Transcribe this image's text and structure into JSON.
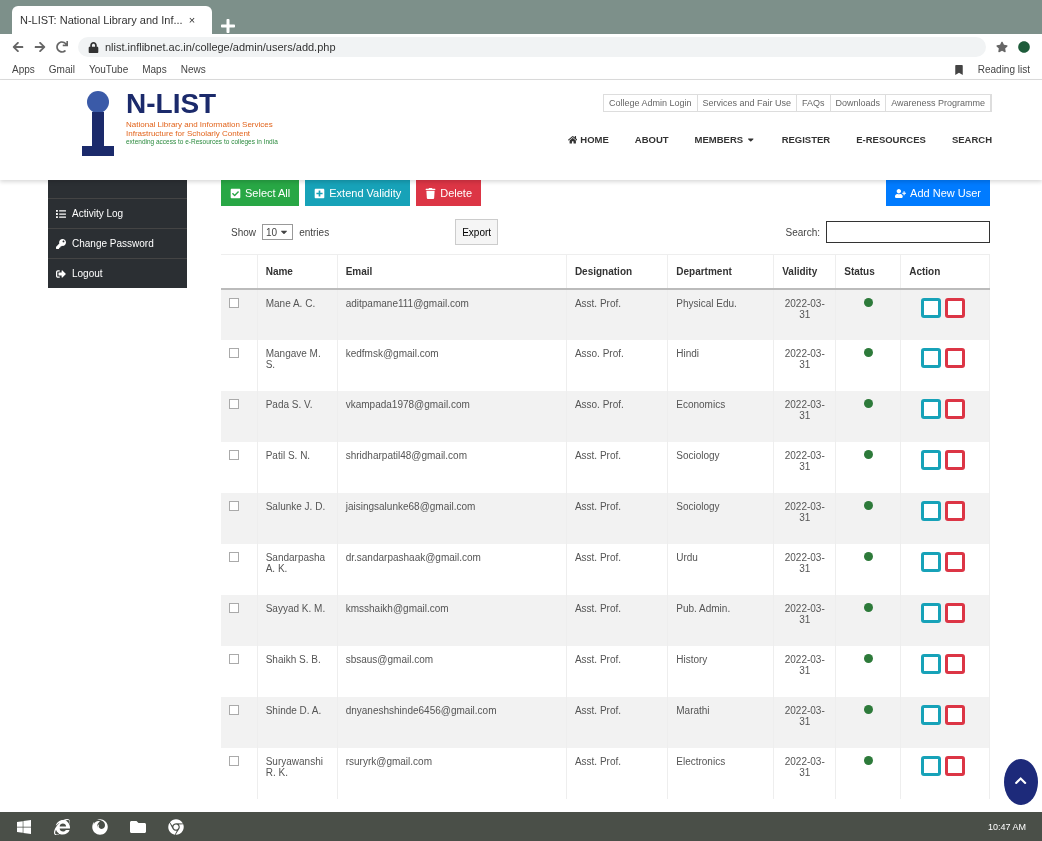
{
  "browser": {
    "tab_title": "N-LIST: National Library and Inf...",
    "tab_close": "×",
    "url": "nlist.inflibnet.ac.in/college/admin/users/add.php",
    "bookmarks": [
      "Apps",
      "Gmail",
      "YouTube",
      "Maps",
      "News"
    ],
    "reading_list": "Reading list"
  },
  "header": {
    "logo_title": "N-LIST",
    "logo_line_1": "National Library and Information Services",
    "logo_line_2": "Infrastructure for Scholarly Content",
    "logo_tagline": "extending access to e-Resources to colleges in India",
    "top_links": [
      "College Admin Login",
      "Services and Fair Use",
      "FAQs",
      "Downloads",
      "Awareness Programme"
    ],
    "nav": [
      {
        "label": "HOME",
        "kind": "home"
      },
      {
        "label": "ABOUT",
        "kind": "plain"
      },
      {
        "label": "MEMBERS",
        "kind": "dropdown"
      },
      {
        "label": "REGISTER",
        "kind": "plain"
      },
      {
        "label": "E-RESOURCES",
        "kind": "plain"
      },
      {
        "label": "SEARCH",
        "kind": "plain"
      }
    ]
  },
  "sidebar": {
    "items": [
      {
        "label": "Activity Log",
        "kind": "list"
      },
      {
        "label": "Change Password",
        "kind": "key"
      },
      {
        "label": "Logout",
        "kind": "logout"
      }
    ]
  },
  "actions": [
    {
      "label": "Select All",
      "kind": "select"
    },
    {
      "label": "Extend Validity",
      "kind": "extend"
    },
    {
      "label": "Delete",
      "kind": "delete"
    }
  ],
  "add_button": "Add New User",
  "length": {
    "before": "Show",
    "value": "10",
    "after": "entries"
  },
  "export_button": "Export",
  "search": {
    "label": "Search:"
  },
  "table": {
    "columns": [
      "Name",
      "Email",
      "Designation",
      "Department",
      "Validity",
      "Status",
      "Action"
    ],
    "rows": [
      {
        "checked": false,
        "name": "Mane A. C.",
        "email": "aditpamane111@gmail.com",
        "designation": "Asst. Prof.",
        "department": "Physical Edu.",
        "validity": "2022-03-31",
        "active": true
      },
      {
        "checked": false,
        "name": "Mangave M. S.",
        "email": "kedfmsk@gmail.com",
        "designation": "Asso. Prof.",
        "department": "Hindi",
        "validity": "2022-03-31",
        "active": true
      },
      {
        "checked": false,
        "name": "Pada S. V.",
        "email": "vkampada1978@gmail.com",
        "designation": "Asso. Prof.",
        "department": "Economics",
        "validity": "2022-03-31",
        "active": true
      },
      {
        "checked": false,
        "name": "Patil S. N.",
        "email": "shridharpatil48@gmail.com",
        "designation": "Asst. Prof.",
        "department": "Sociology",
        "validity": "2022-03-31",
        "active": true
      },
      {
        "checked": false,
        "name": "Salunke J. D.",
        "email": "jaisingsalunke68@gmail.com",
        "designation": "Asst. Prof.",
        "department": "Sociology",
        "validity": "2022-03-31",
        "active": true
      },
      {
        "checked": false,
        "name": "Sandarpasha A. K.",
        "email": "dr.sandarpashaak@gmail.com",
        "designation": "Asst. Prof.",
        "department": "Urdu",
        "validity": "2022-03-31",
        "active": true
      },
      {
        "checked": false,
        "name": "Sayyad K. M.",
        "email": "kmsshaikh@gmail.com",
        "designation": "Asst. Prof.",
        "department": "Pub. Admin.",
        "validity": "2022-03-31",
        "active": true
      },
      {
        "checked": false,
        "name": "Shaikh S. B.",
        "email": "sbsaus@gmail.com",
        "designation": "Asst. Prof.",
        "department": "History",
        "validity": "2022-03-31",
        "active": true
      },
      {
        "checked": false,
        "name": "Shinde D. A.",
        "email": "dnyaneshshinde6456@gmail.com",
        "designation": "Asst. Prof.",
        "department": "Marathi",
        "validity": "2022-03-31",
        "active": true
      },
      {
        "checked": false,
        "name": "Suryawanshi R. K.",
        "email": "rsuryrk@gmail.com",
        "designation": "Asst. Prof.",
        "department": "Electronics",
        "validity": "2022-03-31",
        "active": true
      }
    ]
  },
  "taskbar": {
    "time": "10:47 AM"
  }
}
